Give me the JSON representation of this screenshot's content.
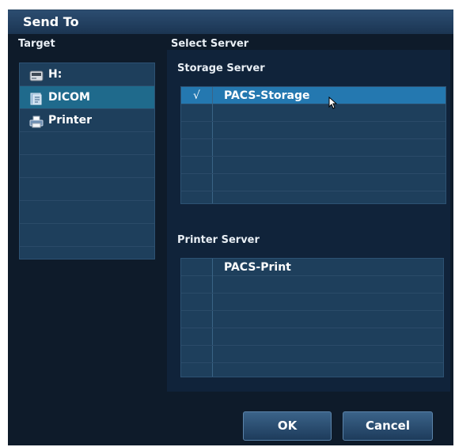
{
  "dialog": {
    "title": "Send To"
  },
  "target": {
    "label": "Target",
    "items": [
      {
        "label": "H:",
        "icon": "drive-icon",
        "selected": false
      },
      {
        "label": "DICOM",
        "icon": "dicom-icon",
        "selected": true
      },
      {
        "label": "Printer",
        "icon": "printer-icon",
        "selected": false
      }
    ]
  },
  "select_server": {
    "label": "Select Server",
    "storage": {
      "label": "Storage Server",
      "rows": [
        {
          "check": "√",
          "name": "PACS-Storage",
          "selected": true
        }
      ]
    },
    "printer": {
      "label": "Printer Server",
      "rows": [
        {
          "check": "",
          "name": "PACS-Print",
          "selected": false
        }
      ]
    }
  },
  "buttons": {
    "ok": "OK",
    "cancel": "Cancel"
  }
}
